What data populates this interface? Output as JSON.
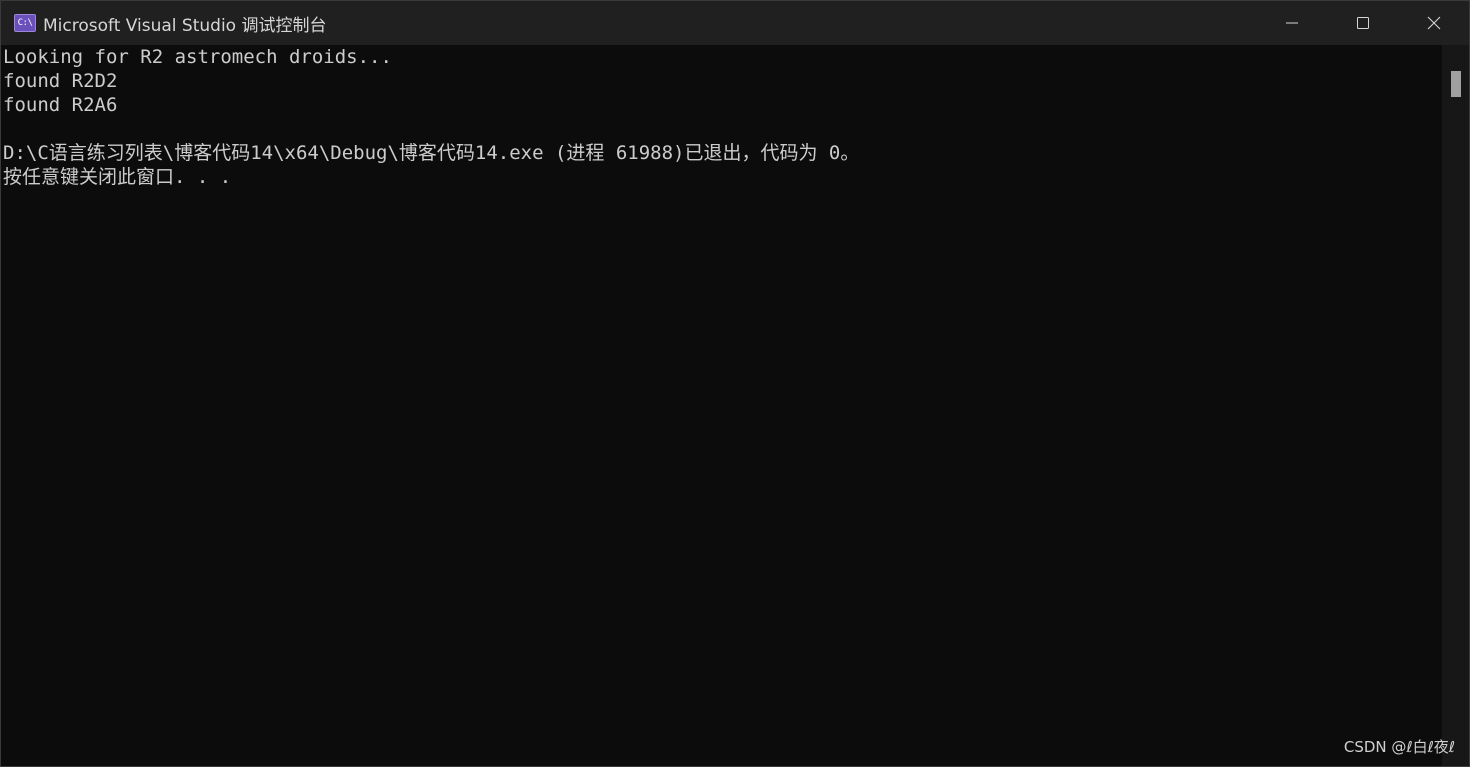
{
  "window": {
    "title": "Microsoft Visual Studio 调试控制台",
    "icon": "visual-studio-console-icon",
    "icon_text": "C:\\"
  },
  "controls": {
    "minimize_icon": "minimize-icon",
    "maximize_icon": "maximize-icon",
    "close_icon": "close-icon"
  },
  "console": {
    "lines": [
      "Looking for R2 astromech droids...",
      "found R2D2",
      "found R2A6",
      "",
      "D:\\C语言练习列表\\博客代码14\\x64\\Debug\\博客代码14.exe (进程 61988)已退出，代码为 0。",
      "按任意键关闭此窗口. . ."
    ]
  },
  "watermark": "CSDN @ℓ白ℓ夜ℓ",
  "colors": {
    "background": "#0c0c0c",
    "titlebar": "#202020",
    "text": "#cccccc",
    "icon_accent": "#6b4fbb"
  }
}
